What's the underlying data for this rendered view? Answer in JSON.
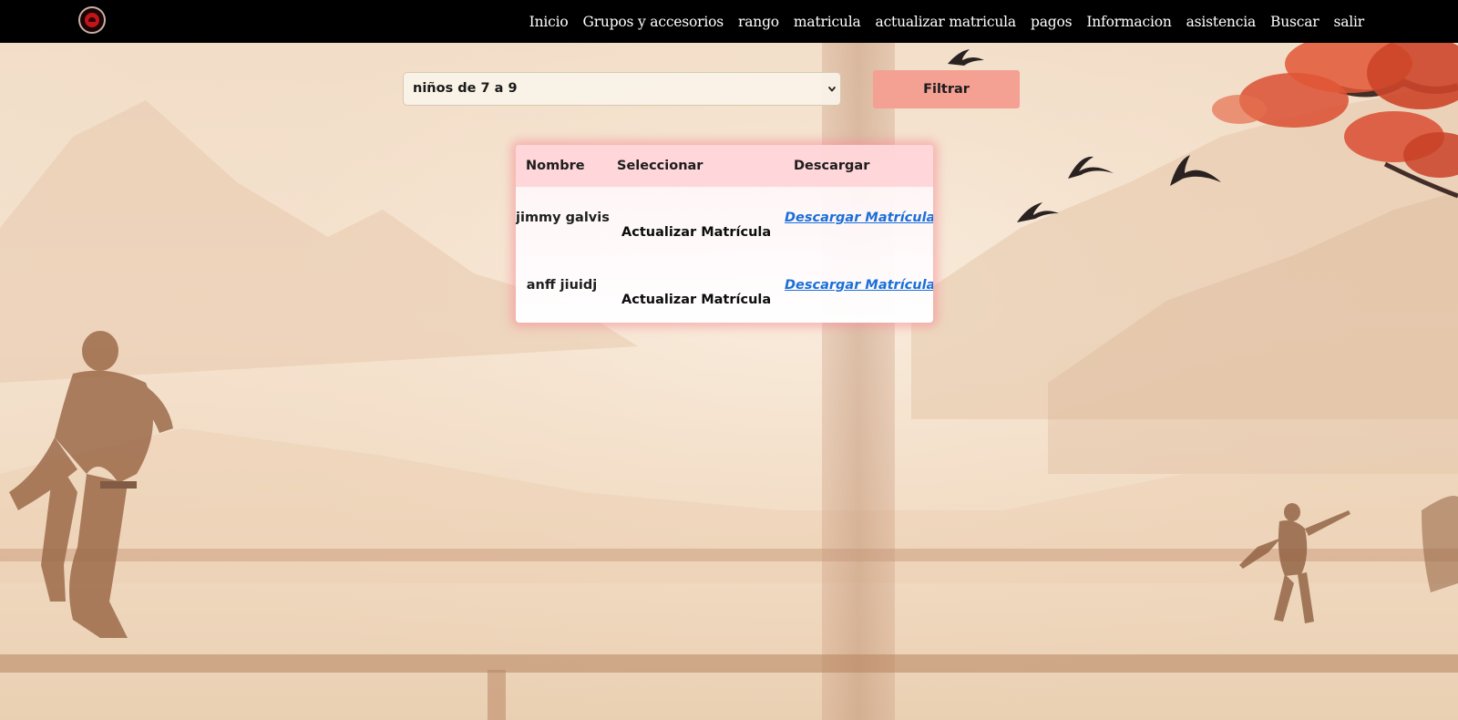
{
  "navbar": {
    "logo_icon": "dojo-logo-icon",
    "links": [
      "Inicio",
      "Grupos y accesorios",
      "rango",
      "matricula",
      "actualizar matricula",
      "pagos",
      "Informacion",
      "asistencia",
      "Buscar",
      "salir"
    ]
  },
  "filter": {
    "selected_group": "niños de 7 a 9",
    "button_label": "Filtrar"
  },
  "table": {
    "headers": [
      "Nombre",
      "Seleccionar",
      "Descargar"
    ],
    "rows": [
      {
        "nombre": "jimmy galvis",
        "accion": "Actualizar Matrícula",
        "descarga": "Descargar Matrícula"
      },
      {
        "nombre": "anff jiuidj",
        "accion": "Actualizar Matrícula",
        "descarga": "Descargar Matrícula"
      }
    ]
  },
  "colors": {
    "navbar_bg": "#000000",
    "filter_button": "#f4a093",
    "table_glow": "#f68c96",
    "link": "#1c6fd8"
  }
}
